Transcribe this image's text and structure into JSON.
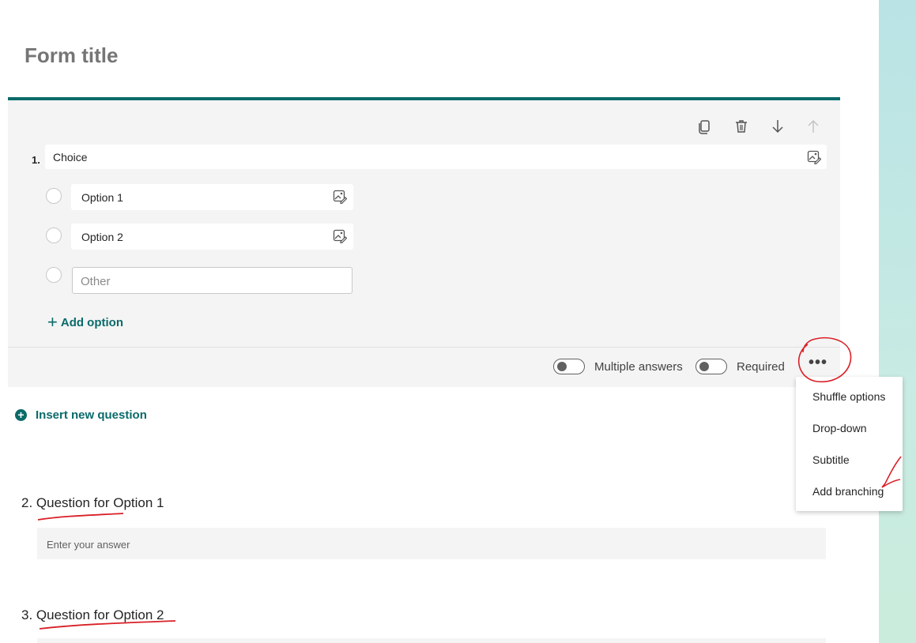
{
  "form": {
    "title": "Form title"
  },
  "question1": {
    "number": "1.",
    "title": "Choice",
    "options": [
      {
        "label": "Option 1"
      },
      {
        "label": "Option 2"
      }
    ],
    "other_placeholder": "Other",
    "add_option_label": "Add option",
    "toolbar_icons": [
      "copy-icon",
      "delete-icon",
      "move-down-icon",
      "move-up-icon"
    ],
    "multiple_answers_label": "Multiple answers",
    "multiple_answers_on": false,
    "required_label": "Required",
    "required_on": false,
    "more_label": "•••"
  },
  "menu": {
    "items": [
      "Shuffle options",
      "Drop-down",
      "Subtitle",
      "Add branching"
    ]
  },
  "insert_question_label": "Insert new question",
  "question2": {
    "number": "2.",
    "title": "Question for Option 1",
    "placeholder": "Enter your answer"
  },
  "question3": {
    "number": "3.",
    "title": "Question for Option 2"
  },
  "colors": {
    "accent": "#0b6a6a",
    "annotation": "#d92027"
  }
}
